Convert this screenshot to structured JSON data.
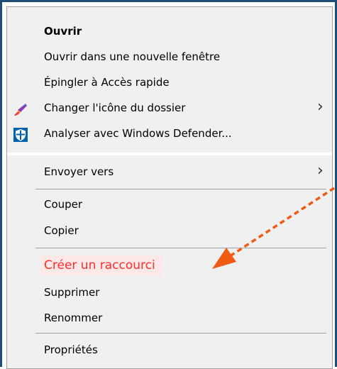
{
  "menu": {
    "items": [
      {
        "label": "Ouvrir"
      },
      {
        "label": "Ouvrir dans une nouvelle fenêtre"
      },
      {
        "label": "Épingler à Accès rapide"
      },
      {
        "label": "Changer l'icône du dossier"
      },
      {
        "label": "Analyser avec Windows Defender..."
      },
      {
        "label": "Envoyer vers"
      },
      {
        "label": "Couper"
      },
      {
        "label": "Copier"
      },
      {
        "label": "Créer un raccourci"
      },
      {
        "label": "Supprimer"
      },
      {
        "label": "Renommer"
      },
      {
        "label": "Propriétés"
      }
    ]
  },
  "icons": {
    "change_icon": "paintbrush-icon",
    "defender": "shield-icon",
    "submenu": "chevron-right-icon"
  },
  "colors": {
    "highlight_text": "#ff2d2d",
    "highlight_bg": "#fde8e8",
    "arrow": "#f05a12",
    "frame": "#1f4e79",
    "defender_blue": "#0063b1"
  }
}
